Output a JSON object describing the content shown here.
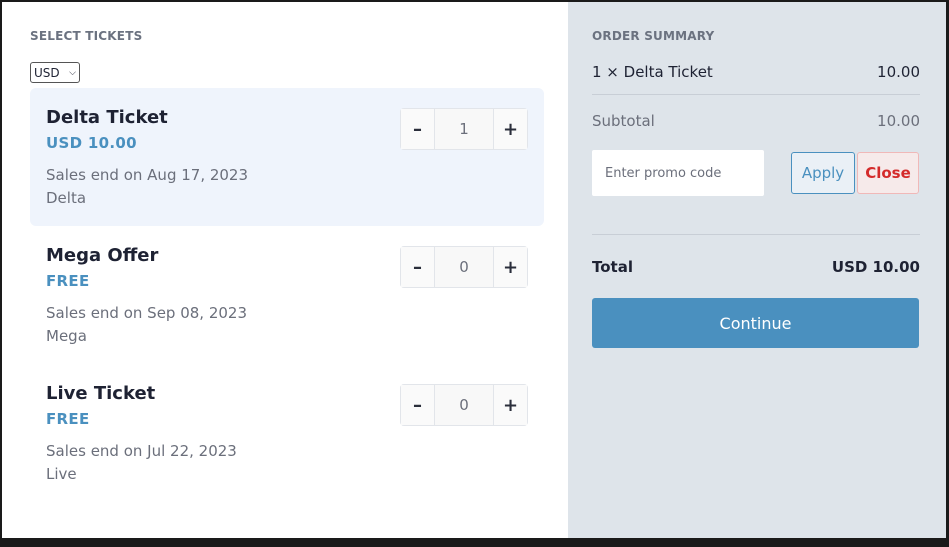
{
  "tickets_panel": {
    "title": "SELECT TICKETS",
    "currency": "USD",
    "tickets": [
      {
        "name": "Delta Ticket",
        "price": "USD 10.00",
        "sales_end": "Sales end on Aug 17, 2023",
        "description": "Delta",
        "quantity": "1",
        "minus": "–",
        "plus": "+"
      },
      {
        "name": "Mega Offer",
        "price": "FREE",
        "sales_end": "Sales end on Sep 08, 2023",
        "description": "Mega",
        "quantity": "0",
        "minus": "–",
        "plus": "+"
      },
      {
        "name": "Live Ticket",
        "price": "FREE",
        "sales_end": "Sales end on Jul 22, 2023",
        "description": "Live",
        "quantity": "0",
        "minus": "–",
        "plus": "+"
      }
    ]
  },
  "order_summary": {
    "title": "ORDER SUMMARY",
    "line_item": {
      "label": "1 × Delta Ticket",
      "amount": "10.00"
    },
    "subtotal": {
      "label": "Subtotal",
      "amount": "10.00"
    },
    "promo": {
      "placeholder": "Enter promo code",
      "apply_label": "Apply",
      "close_label": "Close"
    },
    "total": {
      "label": "Total",
      "amount": "USD 10.00"
    },
    "continue_label": "Continue"
  },
  "colors": {
    "accent": "#4a90bf",
    "danger": "#d42a2a",
    "summary_bg": "#dee4ea",
    "selected_bg": "#eff4fc"
  }
}
